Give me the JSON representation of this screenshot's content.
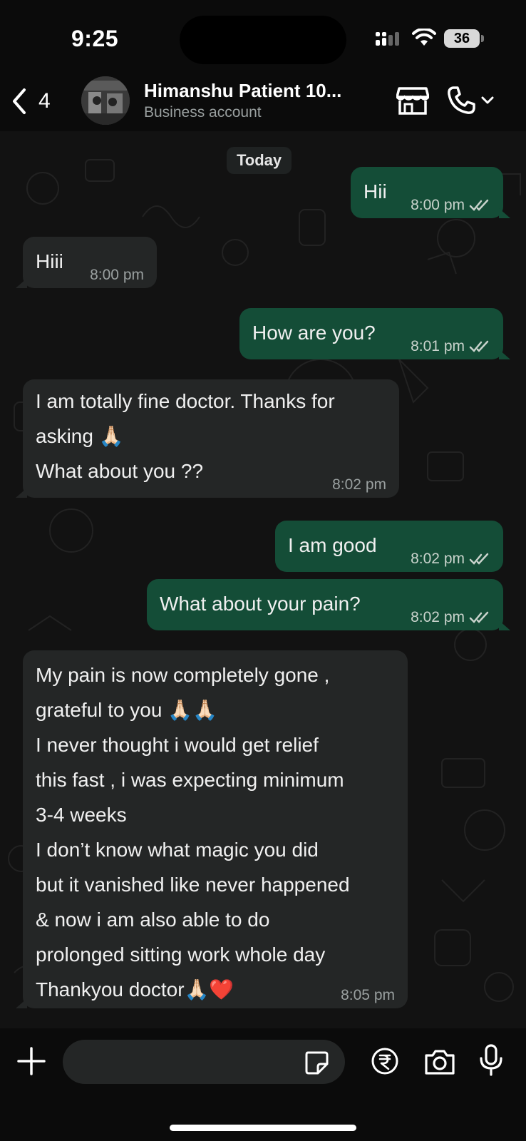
{
  "status_bar": {
    "time": "9:25",
    "battery": "36"
  },
  "header": {
    "back_count": "4",
    "contact_name": "Himanshu Patient 10...",
    "contact_subtitle": "Business account"
  },
  "chat": {
    "date_divider": "Today",
    "messages": [
      {
        "direction": "out",
        "text": "Hii",
        "time": "8:00 pm",
        "status": "read"
      },
      {
        "direction": "in",
        "text": "Hiii",
        "time": "8:00 pm"
      },
      {
        "direction": "out",
        "text": "How are you?",
        "time": "8:01 pm",
        "status": "read"
      },
      {
        "direction": "in",
        "text": "I am totally fine doctor. Thanks for\nasking 🙏🏻\nWhat about you ??",
        "time": "8:02 pm"
      },
      {
        "direction": "out",
        "text": "I am good",
        "time": "8:02 pm",
        "status": "read"
      },
      {
        "direction": "out",
        "text": "What about your pain?",
        "time": "8:02 pm",
        "status": "read"
      },
      {
        "direction": "in",
        "text": "My pain is now completely gone ,\ngrateful to you 🙏🏻🙏🏻\nI never thought i would get relief\nthis fast , i was expecting minimum\n3-4 weeks\nI don’t know what magic you did\nbut it vanished like never happened\n& now i am also able to do\nprolonged sitting work whole day\nThankyou doctor🙏🏻❤️",
        "time": "8:05 pm"
      }
    ]
  },
  "input_bar": {
    "placeholder": ""
  },
  "colors": {
    "outgoing_bubble": "#144d37",
    "incoming_bubble": "#242626",
    "background": "#0b0b0b",
    "read_ticks": "#c9d3cc"
  },
  "icons": [
    "back-chevron-icon",
    "store-icon",
    "phone-icon",
    "chevron-down-icon",
    "plus-icon",
    "sticker-icon",
    "rupee-icon",
    "camera-icon",
    "mic-icon",
    "double-check-icon"
  ]
}
